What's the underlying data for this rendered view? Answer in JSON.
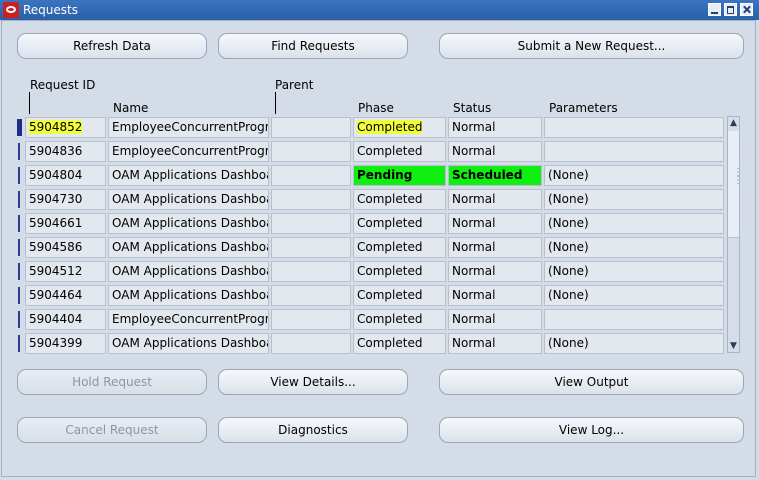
{
  "window": {
    "title": "Requests"
  },
  "buttons": {
    "refresh": "Refresh Data",
    "find": "Find Requests",
    "submit": "Submit a New Request...",
    "hold": "Hold Request",
    "view_details": "View Details...",
    "view_output": "View Output",
    "cancel": "Cancel Request",
    "diagnostics": "Diagnostics",
    "view_log": "View Log..."
  },
  "columns": {
    "request_id": "Request ID",
    "parent": "Parent",
    "name": "Name",
    "phase": "Phase",
    "status": "Status",
    "parameters": "Parameters"
  },
  "rows": [
    {
      "id": "5904852",
      "name": "EmployeeConcurrentProgra",
      "parent": "",
      "phase": "Completed",
      "status": "Normal",
      "params": ""
    },
    {
      "id": "5904836",
      "name": "EmployeeConcurrentProgra",
      "parent": "",
      "phase": "Completed",
      "status": "Normal",
      "params": ""
    },
    {
      "id": "5904804",
      "name": "OAM Applications Dashboa",
      "parent": "",
      "phase": "Pending",
      "status": "Scheduled",
      "params": "(None)"
    },
    {
      "id": "5904730",
      "name": "OAM Applications Dashboa",
      "parent": "",
      "phase": "Completed",
      "status": "Normal",
      "params": "(None)"
    },
    {
      "id": "5904661",
      "name": "OAM Applications Dashboa",
      "parent": "",
      "phase": "Completed",
      "status": "Normal",
      "params": "(None)"
    },
    {
      "id": "5904586",
      "name": "OAM Applications Dashboa",
      "parent": "",
      "phase": "Completed",
      "status": "Normal",
      "params": "(None)"
    },
    {
      "id": "5904512",
      "name": "OAM Applications Dashboa",
      "parent": "",
      "phase": "Completed",
      "status": "Normal",
      "params": "(None)"
    },
    {
      "id": "5904464",
      "name": "OAM Applications Dashboa",
      "parent": "",
      "phase": "Completed",
      "status": "Normal",
      "params": "(None)"
    },
    {
      "id": "5904404",
      "name": "EmployeeConcurrentProgra",
      "parent": "",
      "phase": "Completed",
      "status": "Normal",
      "params": ""
    },
    {
      "id": "5904399",
      "name": "OAM Applications Dashboa",
      "parent": "",
      "phase": "Completed",
      "status": "Normal",
      "params": "(None)"
    }
  ],
  "colors": {
    "titlebar": "#2a5fa6",
    "highlight": "#f1ff3a",
    "pending": "#10f010"
  }
}
